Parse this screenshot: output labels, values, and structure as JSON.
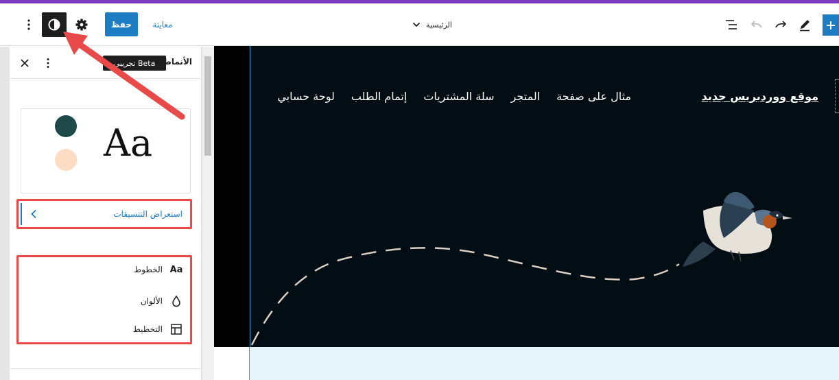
{
  "toolbar": {
    "save_label": "حفظ",
    "preview_label": "معاينة",
    "document_title": "الرئيسية",
    "accent_color": "#1e7dc2"
  },
  "sidebar": {
    "title": "الأنماط",
    "beta_badge": "تجريبي Beta",
    "preview_text": "Aa",
    "preview_colors": [
      "#1e4a4a",
      "#fcdcc3"
    ],
    "browse_styles_label": "استعراض التنسيقات",
    "items": [
      {
        "label": "الخطوط",
        "icon": "typography-icon",
        "icon_text": "Aa"
      },
      {
        "label": "الألوان",
        "icon": "droplet-icon"
      },
      {
        "label": "التخطيط",
        "icon": "layout-icon"
      }
    ]
  },
  "site": {
    "title": "موقع ووردبريس جديد",
    "nav": [
      "مثال على صفحة",
      "المتجر",
      "سلة المشتريات",
      "إتمام الطلب",
      "لوحة حسابي"
    ],
    "hero_background": "#020d14",
    "below_background": "#e5f3fa"
  },
  "annotations": {
    "highlight_color": "#e84a4a"
  }
}
